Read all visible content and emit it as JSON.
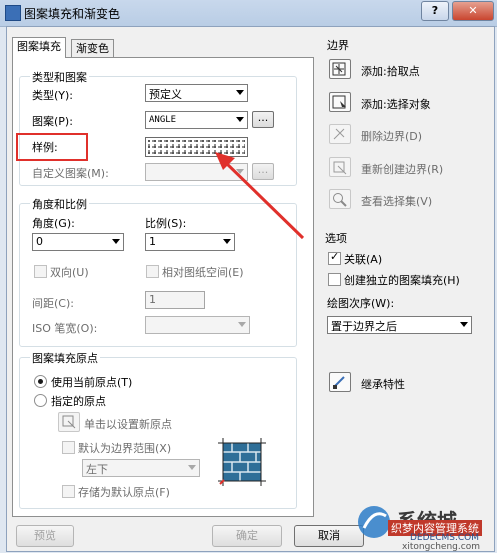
{
  "window": {
    "title": "图案填充和渐变色",
    "help": "?",
    "close": "✕"
  },
  "tabs": [
    "图案填充",
    "渐变色"
  ],
  "type_pattern": {
    "title": "类型和图案",
    "type_label": "类型(Y):",
    "type_value": "预定义",
    "pattern_label": "图案(P):",
    "pattern_value": "ANGLE",
    "swatch_label": "样例:",
    "custom_label": "自定义图案(M):",
    "ellipsis": "..."
  },
  "angle_scale": {
    "title": "角度和比例",
    "angle_label": "角度(G):",
    "angle_value": "0",
    "scale_label": "比例(S):",
    "scale_value": "1",
    "double_label": "双向(U)",
    "relative_label": "相对图纸空间(E)",
    "spacing_label": "间距(C):",
    "spacing_value": "1",
    "iso_label": "ISO 笔宽(O):"
  },
  "origin": {
    "title": "图案填充原点",
    "use_current": "使用当前原点(T)",
    "specified": "指定的原点",
    "click_set": "单击以设置新原点",
    "default_extent": "默认为边界范围(X)",
    "position_value": "左下",
    "store_default": "存储为默认原点(F)"
  },
  "boundary": {
    "title": "边界",
    "items": [
      "添加:拾取点",
      "添加:选择对象",
      "删除边界(D)",
      "重新创建边界(R)",
      "查看选择集(V)"
    ]
  },
  "options": {
    "title": "选项",
    "associative": "关联(A)",
    "create_separate": "创建独立的图案填充(H)",
    "draw_order_label": "绘图次序(W):",
    "draw_order_value": "置于边界之后"
  },
  "inherit": "继承特性",
  "buttons": {
    "preview": "预览",
    "ok": "确定",
    "cancel": "取消"
  },
  "watermark": {
    "site": "xitongcheng.com",
    "name": "系统城",
    "brand": "织梦内容管理系统",
    "url": "DEDECMS.COM"
  },
  "colors": {
    "highlight": "#e0302b",
    "accent": "#3b6fb6"
  }
}
